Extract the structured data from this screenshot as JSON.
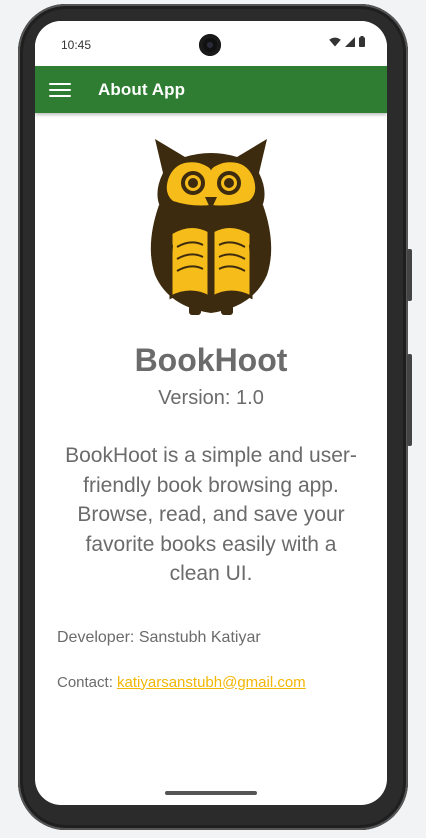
{
  "status_bar": {
    "time": "10:45",
    "icons": [
      "wifi-icon",
      "signal-icon",
      "battery-icon"
    ]
  },
  "app_bar": {
    "title": "About App",
    "menu_icon": "hamburger-menu-icon",
    "color": "#2e7d32"
  },
  "about": {
    "logo_icon": "owl-reading-book-logo",
    "app_name": "BookHoot",
    "version": "Version: 1.0",
    "description": "BookHoot is a simple and user-friendly book browsing app. Browse, read, and save your favorite books easily with a clean UI.",
    "developer": "Developer: Sanstubh Katiyar",
    "contact_label": "Contact: ",
    "contact_email": "katiyarsanstubh@gmail.com"
  },
  "colors": {
    "accent": "#f2b705",
    "text": "#6b6b6b",
    "owl_body": "#3d2b0f",
    "owl_yellow": "#f6bc1a"
  }
}
